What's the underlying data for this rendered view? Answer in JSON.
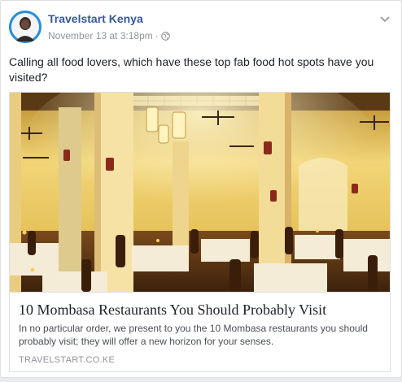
{
  "post": {
    "author": "Travelstart Kenya",
    "timestamp": "November 13 at 3:18pm",
    "separator": "·",
    "privacy_icon": "globe-icon",
    "menu_icon": "chevron-down-icon",
    "status_text": "Calling all food lovers, which have these top fab food hot spots have you visited?"
  },
  "link_preview": {
    "image_subject": "restaurant-interior-photo",
    "title": "10 Mombasa Restaurants You Should Probably Visit",
    "description": "In no particular order, we present to you the 10 Mombasa restaurants you should probably visit; they will offer a new horizon for your senses.",
    "domain": "TRAVELSTART.CO.KE"
  },
  "colors": {
    "author_link": "#365899",
    "meta_text": "#90949c",
    "card_border": "#dddfe2",
    "avatar_bg": "#2b8fd6"
  }
}
